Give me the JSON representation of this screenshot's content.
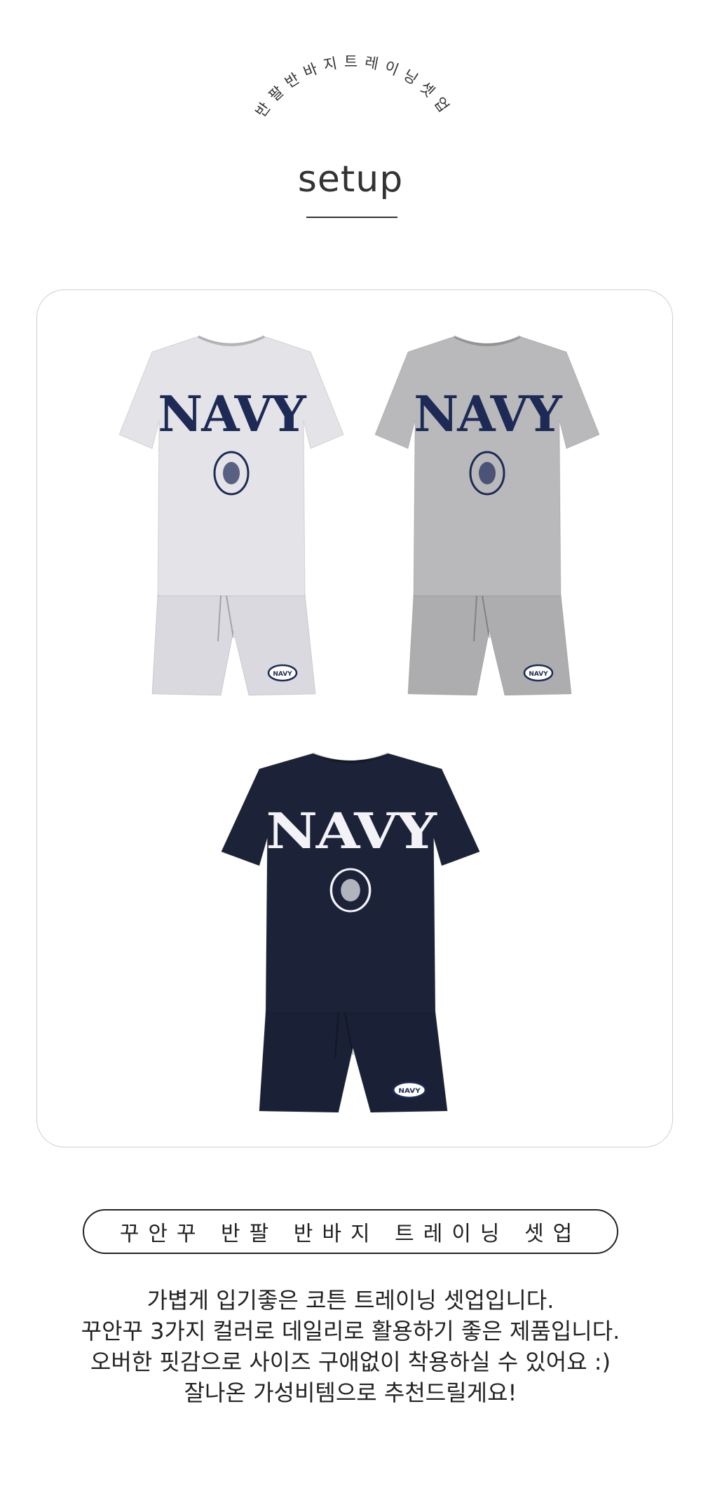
{
  "header": {
    "arc_text": "반팔반바지트레이닝셋업",
    "title": "setup"
  },
  "products": [
    {
      "name": "NAVY",
      "shirt_color": "#e4e4e8",
      "shorts_color": "#d9d9df",
      "print_color": "#1d2a55",
      "badge": "NAVY"
    },
    {
      "name": "NAVY",
      "shirt_color": "#b9b9bb",
      "shorts_color": "#adadaf",
      "print_color": "#1d2a55",
      "badge": "NAVY"
    },
    {
      "name": "NAVY",
      "shirt_color": "#1c2238",
      "shorts_color": "#1a2036",
      "print_color": "#f2f2f7",
      "badge": "NAVY"
    }
  ],
  "pill": {
    "label": "꾸안꾸 반팔 반바지 트레이닝 셋업"
  },
  "description": {
    "lines": [
      "가볍게 입기좋은 코튼 트레이닝 셋업입니다.",
      "꾸안꾸 3가지 컬러로 데일리로 활용하기 좋은 제품입니다.",
      "오버한 핏감으로 사이즈 구애없이 착용하실 수 있어요 :)",
      "잘나온 가성비템으로 추천드릴게요!"
    ]
  }
}
